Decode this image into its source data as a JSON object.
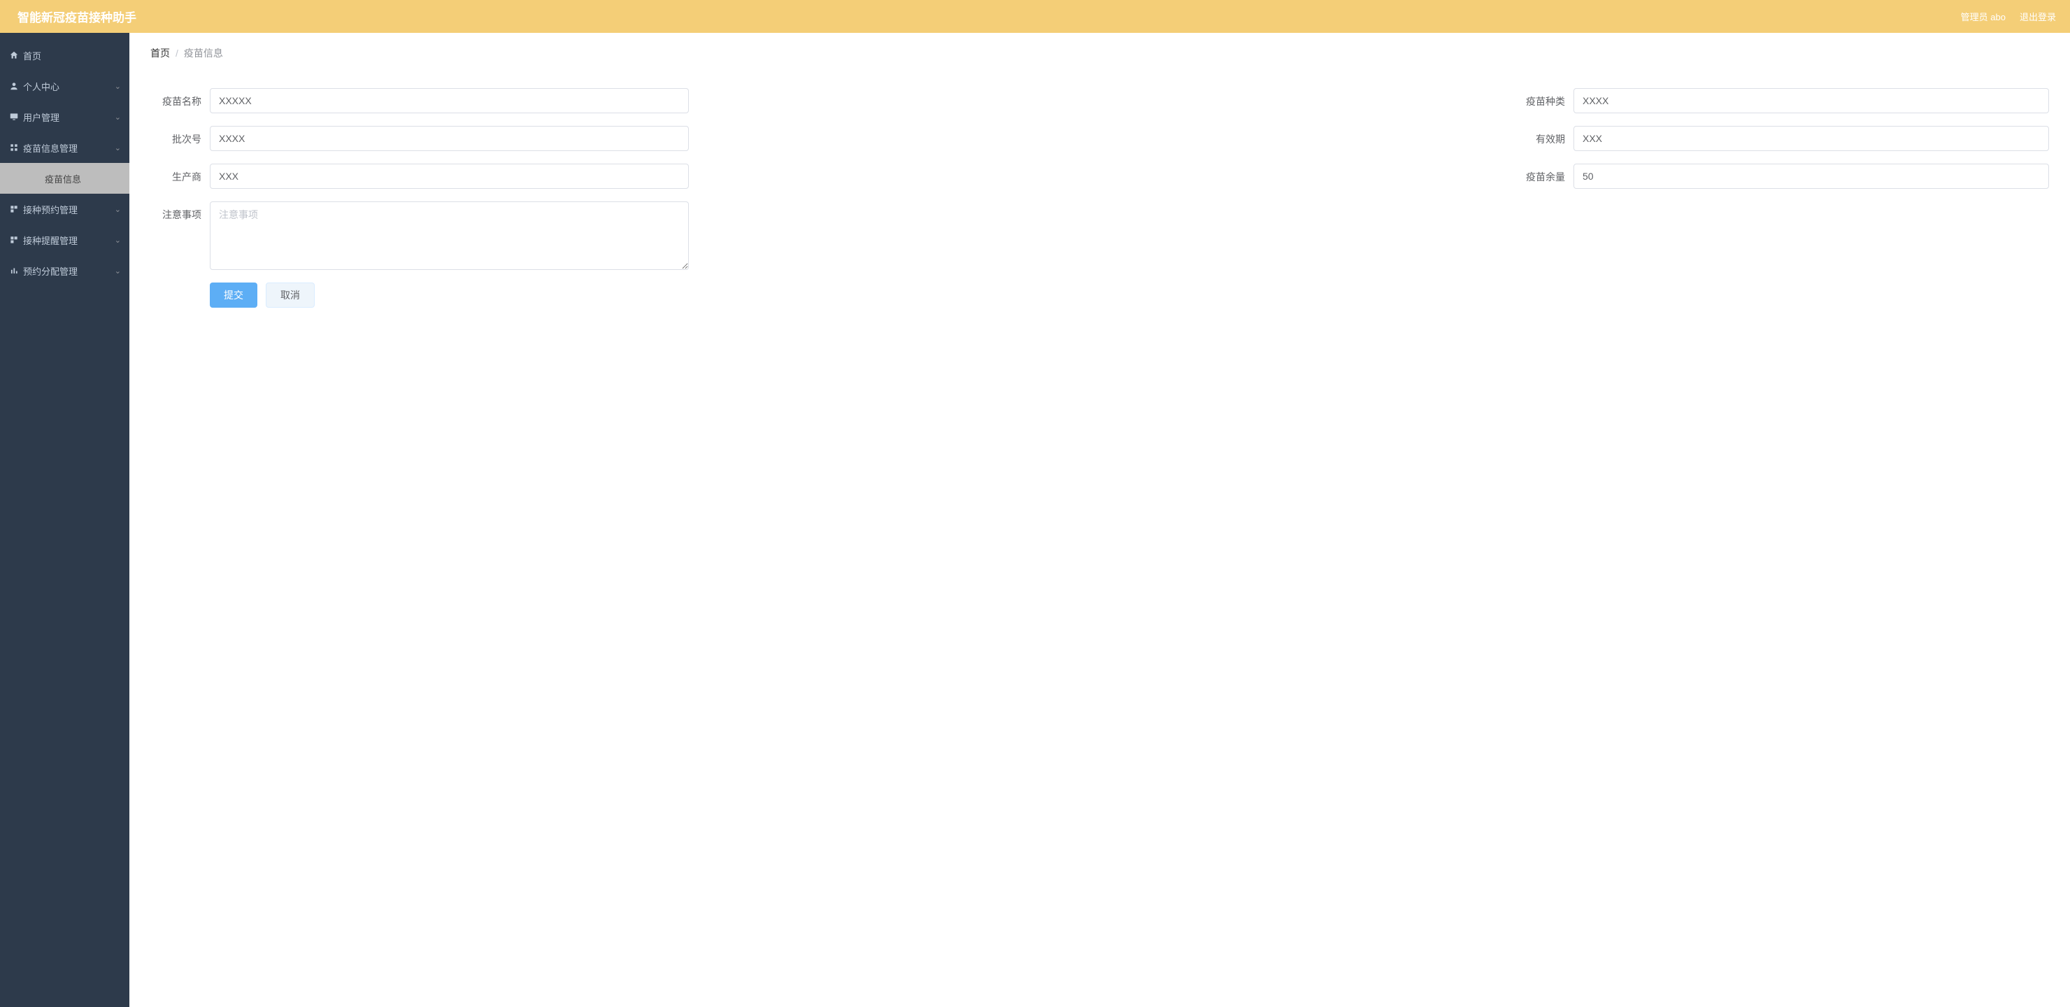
{
  "header": {
    "title": "智能新冠疫苗接种助手",
    "admin_label": "管理员 abo",
    "logout_label": "退出登录"
  },
  "sidebar": {
    "items": [
      {
        "key": "home",
        "label": "首页",
        "icon": "home",
        "has_children": false
      },
      {
        "key": "personal",
        "label": "个人中心",
        "icon": "user",
        "has_children": true
      },
      {
        "key": "user-mgmt",
        "label": "用户管理",
        "icon": "monitor",
        "has_children": true
      },
      {
        "key": "vaccine-info-mgmt",
        "label": "疫苗信息管理",
        "icon": "grid",
        "has_children": true
      },
      {
        "key": "vaccine-info",
        "label": "疫苗信息",
        "icon": "",
        "has_children": false,
        "sub": true,
        "active": true
      },
      {
        "key": "appointment-mgmt",
        "label": "接种预约管理",
        "icon": "squares",
        "has_children": true
      },
      {
        "key": "reminder-mgmt",
        "label": "接种提醒管理",
        "icon": "squares",
        "has_children": true
      },
      {
        "key": "allocation-mgmt",
        "label": "预约分配管理",
        "icon": "bars",
        "has_children": true
      }
    ]
  },
  "breadcrumb": {
    "home": "首页",
    "current": "疫苗信息",
    "sep": "/"
  },
  "form": {
    "fields": {
      "vaccine_name": {
        "label": "疫苗名称",
        "value": "XXXXX"
      },
      "vaccine_type": {
        "label": "疫苗种类",
        "value": "XXXX"
      },
      "batch_no": {
        "label": "批次号",
        "value": "XXXX"
      },
      "valid_date": {
        "label": "有效期",
        "value": "XXX"
      },
      "producer": {
        "label": "生产商",
        "value": "XXX"
      },
      "remaining": {
        "label": "疫苗余量",
        "value": "50"
      },
      "notes": {
        "label": "注意事项",
        "placeholder": "注意事项",
        "value": ""
      }
    },
    "buttons": {
      "submit": "提交",
      "cancel": "取消"
    }
  }
}
